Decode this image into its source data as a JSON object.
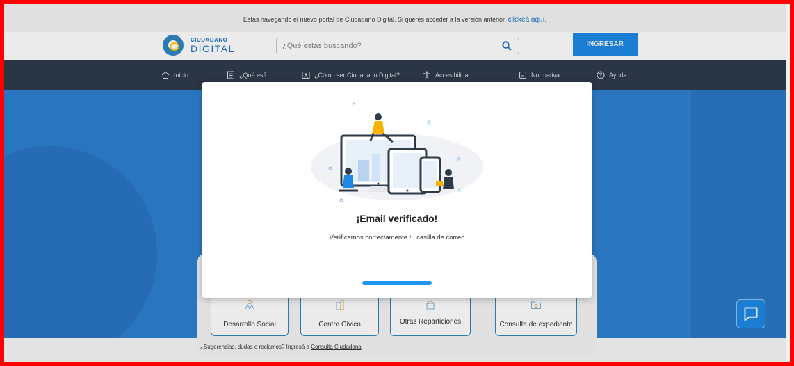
{
  "notice": {
    "text": "Estás navegando el nuevo portal de Ciudadano Digital. Si querés acceder a la versión anterior,",
    "link": "clickeá aquí."
  },
  "header": {
    "logo_top": "CIUDADANO",
    "logo_bottom": "DIGITAL",
    "search_placeholder": "¿Qué estás buscando?",
    "login_label": "INGRESAR"
  },
  "nav": {
    "items": [
      {
        "label": "Inicio",
        "icon": "home-icon"
      },
      {
        "label": "¿Qué es?",
        "icon": "document-icon"
      },
      {
        "label": "¿Cómo ser Ciudadano Digital?",
        "icon": "id-card-icon"
      },
      {
        "label": "Accesibilidad",
        "icon": "accessibility-icon"
      },
      {
        "label": "Normativa",
        "icon": "regulation-icon"
      },
      {
        "label": "Ayuda",
        "icon": "help-icon"
      }
    ]
  },
  "cards": [
    {
      "label": "Desarrollo Social",
      "icon": "social-icon"
    },
    {
      "label": "Centro Cívico",
      "icon": "building-icon"
    },
    {
      "label": "Otras Reparticiones",
      "icon": "office-icon"
    },
    {
      "label": "Consulta de expediente",
      "icon": "folder-icon"
    }
  ],
  "footer": {
    "text": "¿Sugerencias, dudas o reclamos? Ingresá a",
    "link": "Consulta Ciudadana"
  },
  "modal": {
    "title": "¡Email verificado!",
    "message": "Verificamos correctamente tu casilla de correo"
  },
  "colors": {
    "accent": "#1e88e5",
    "nav_bg": "#2e3a4b",
    "hero_bg": "#2e7fd0"
  }
}
